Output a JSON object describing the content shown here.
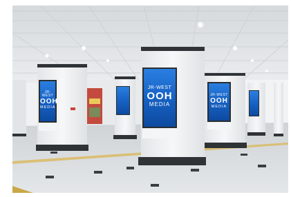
{
  "photo": {
    "subject": "",
    "colors": {
      "ceiling": "#e6e8ea",
      "floor": "#d7dbde",
      "pillar": "#eef0f1",
      "pillar_base": "#2f3336",
      "screen_blue": "#1f6fd0",
      "light": "#ffffff"
    }
  },
  "ads": [
    {
      "line1": "JR-WEST",
      "line2": "OOH",
      "line3": "MEDIA"
    },
    {
      "line1": "JR-WEST",
      "line2": "OOH",
      "line3": "MEDIA"
    },
    {
      "line1": "JR-WEST",
      "line2": "OOH",
      "line3": "MEDIA"
    }
  ]
}
